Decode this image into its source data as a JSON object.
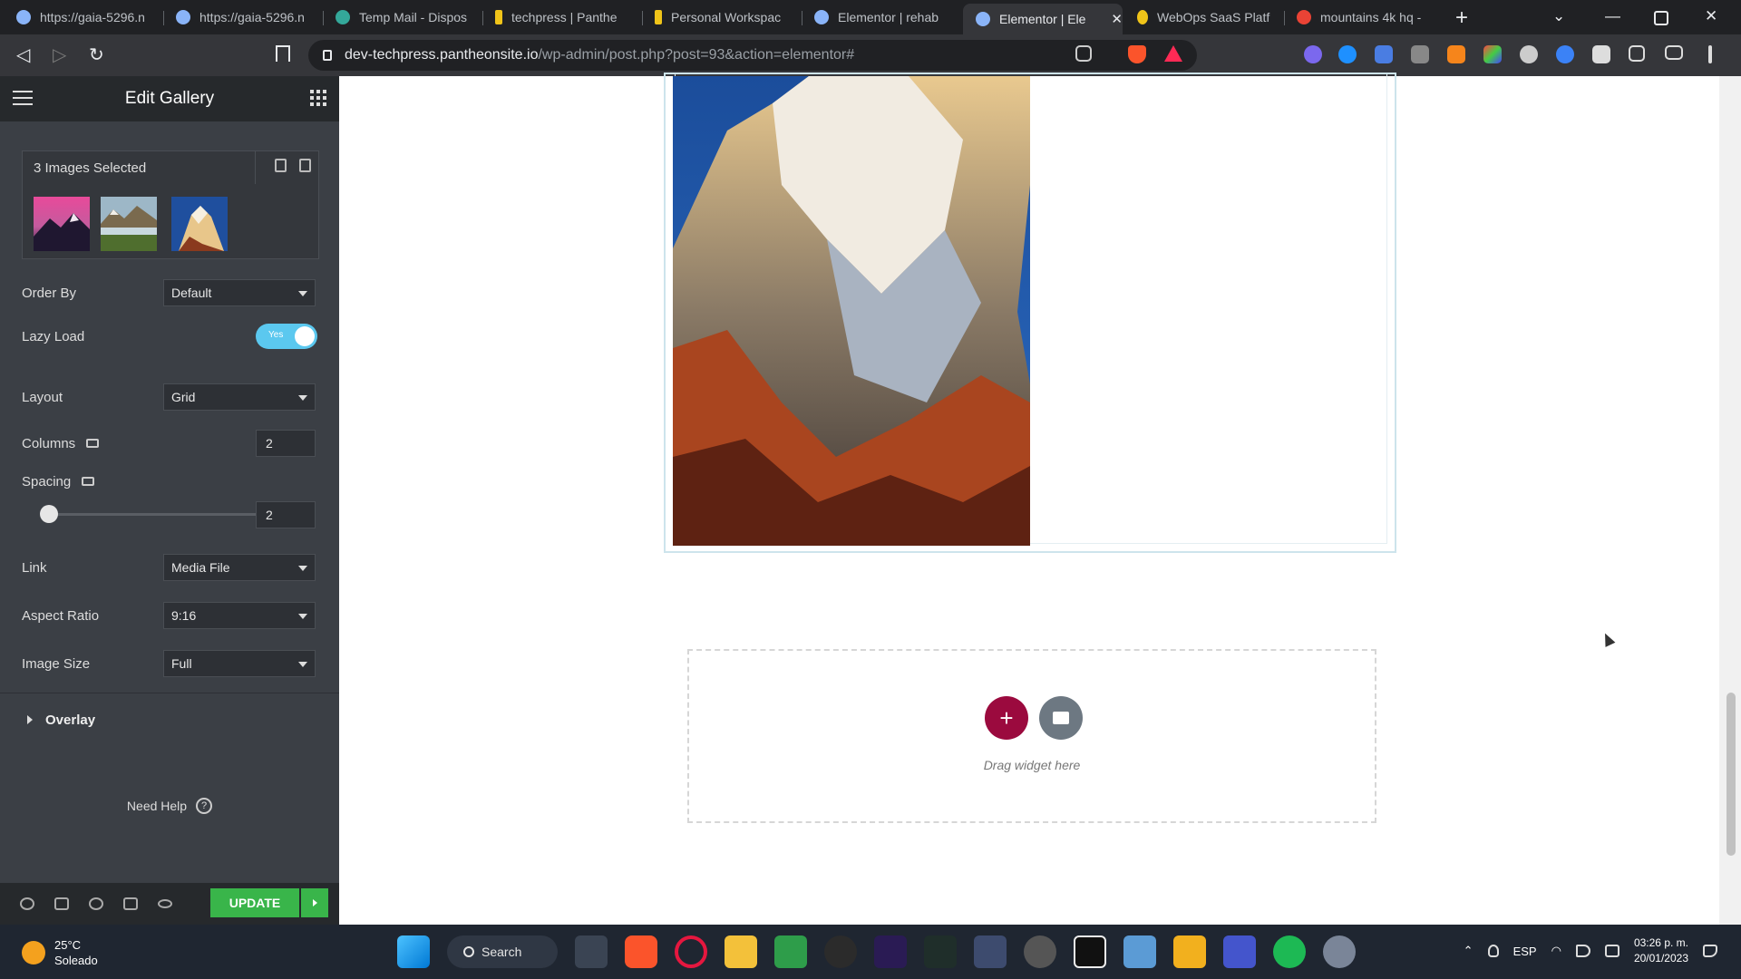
{
  "browser": {
    "tabs": [
      {
        "title": "https://gaia-5296.n",
        "color": "#8ab4f8"
      },
      {
        "title": "https://gaia-5296.n",
        "color": "#8ab4f8"
      },
      {
        "title": "Temp Mail - Dispos",
        "color": "#34a89a"
      },
      {
        "title": "techpress | Panthe",
        "color": "#f0c419"
      },
      {
        "title": "Personal Workspac",
        "color": "#f0c419"
      },
      {
        "title": "Elementor | rehab",
        "color": "#8ab4f8"
      },
      {
        "title": "Elementor | Ele",
        "color": "#8ab4f8",
        "active": true
      },
      {
        "title": "WebOps SaaS Platf",
        "color": "#f0c419"
      },
      {
        "title": "mountains 4k hq -",
        "color": "#ea4335"
      }
    ],
    "url_host": "dev-techpress.pantheonsite.io",
    "url_path": "/wp-admin/post.php?post=93&action=elementor#"
  },
  "panel": {
    "title": "Edit Gallery",
    "gallery_label": "3 Images Selected",
    "order_by": {
      "label": "Order By",
      "value": "Default"
    },
    "lazy_load": {
      "label": "Lazy Load",
      "state": "on",
      "text": "Yes"
    },
    "layout": {
      "label": "Layout",
      "value": "Grid"
    },
    "columns": {
      "label": "Columns",
      "value": "2"
    },
    "spacing": {
      "label": "Spacing",
      "value": "2"
    },
    "link": {
      "label": "Link",
      "value": "Media File"
    },
    "aspect_ratio": {
      "label": "Aspect Ratio",
      "value": "9:16"
    },
    "image_size": {
      "label": "Image Size",
      "value": "Full"
    },
    "overlay": "Overlay",
    "help": "Need Help",
    "update": "UPDATE"
  },
  "canvas": {
    "drag_text": "Drag widget here"
  },
  "taskbar": {
    "temperature": "25°C",
    "condition": "Soleado",
    "search": "Search",
    "lang": "ESP",
    "time": "03:26 p. m.",
    "date": "20/01/2023"
  }
}
